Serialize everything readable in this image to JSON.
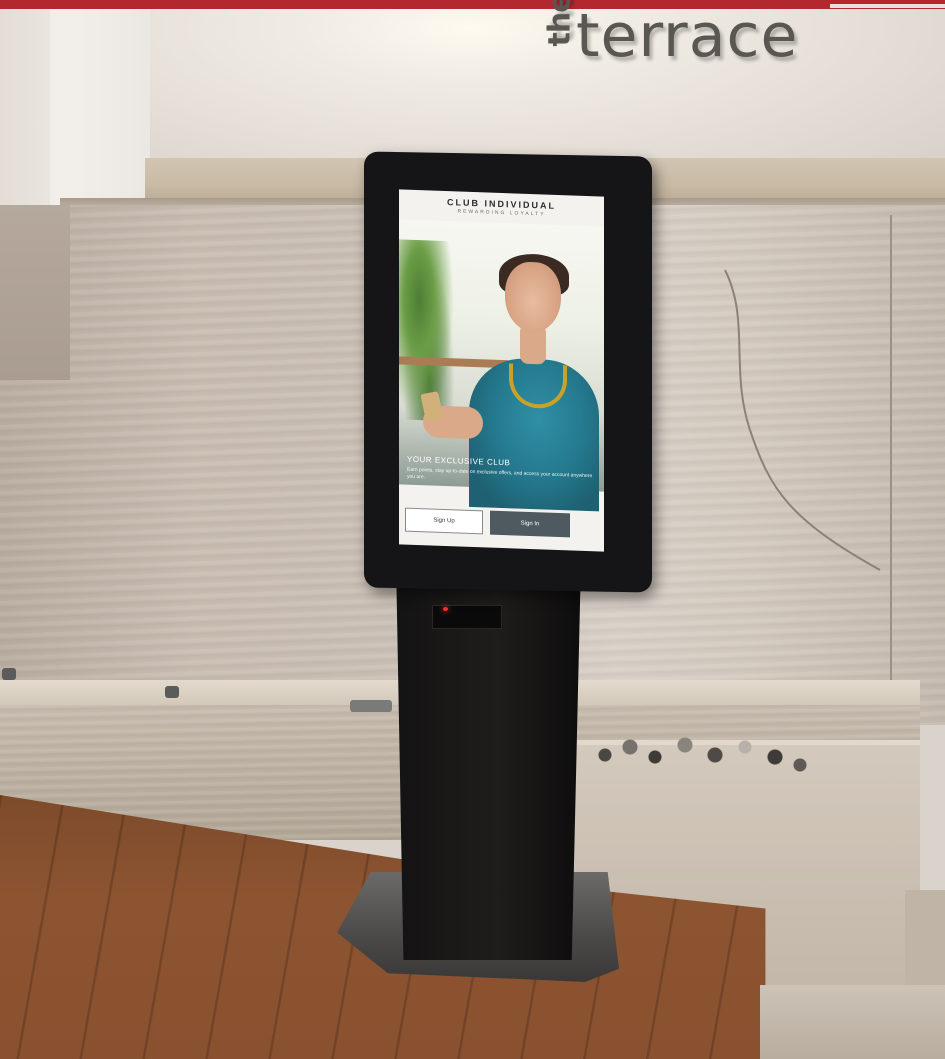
{
  "brand": {
    "the": "the",
    "word": "terrace"
  },
  "kiosk_screen": {
    "app_name": "CLUB INDIVIDUAL",
    "tagline": "REWARDING LOYALTY",
    "headline": "YOUR EXCLUSIVE CLUB",
    "body": "Earn points, stay up-to-date on exclusive offers, and access your account anywhere you are.",
    "signup_label": "Sign Up",
    "signin_label": "Sign In"
  },
  "colors": {
    "top_strip": "#b3272f",
    "signin_button": "#4e5a60",
    "kiosk_body": "#151416"
  }
}
